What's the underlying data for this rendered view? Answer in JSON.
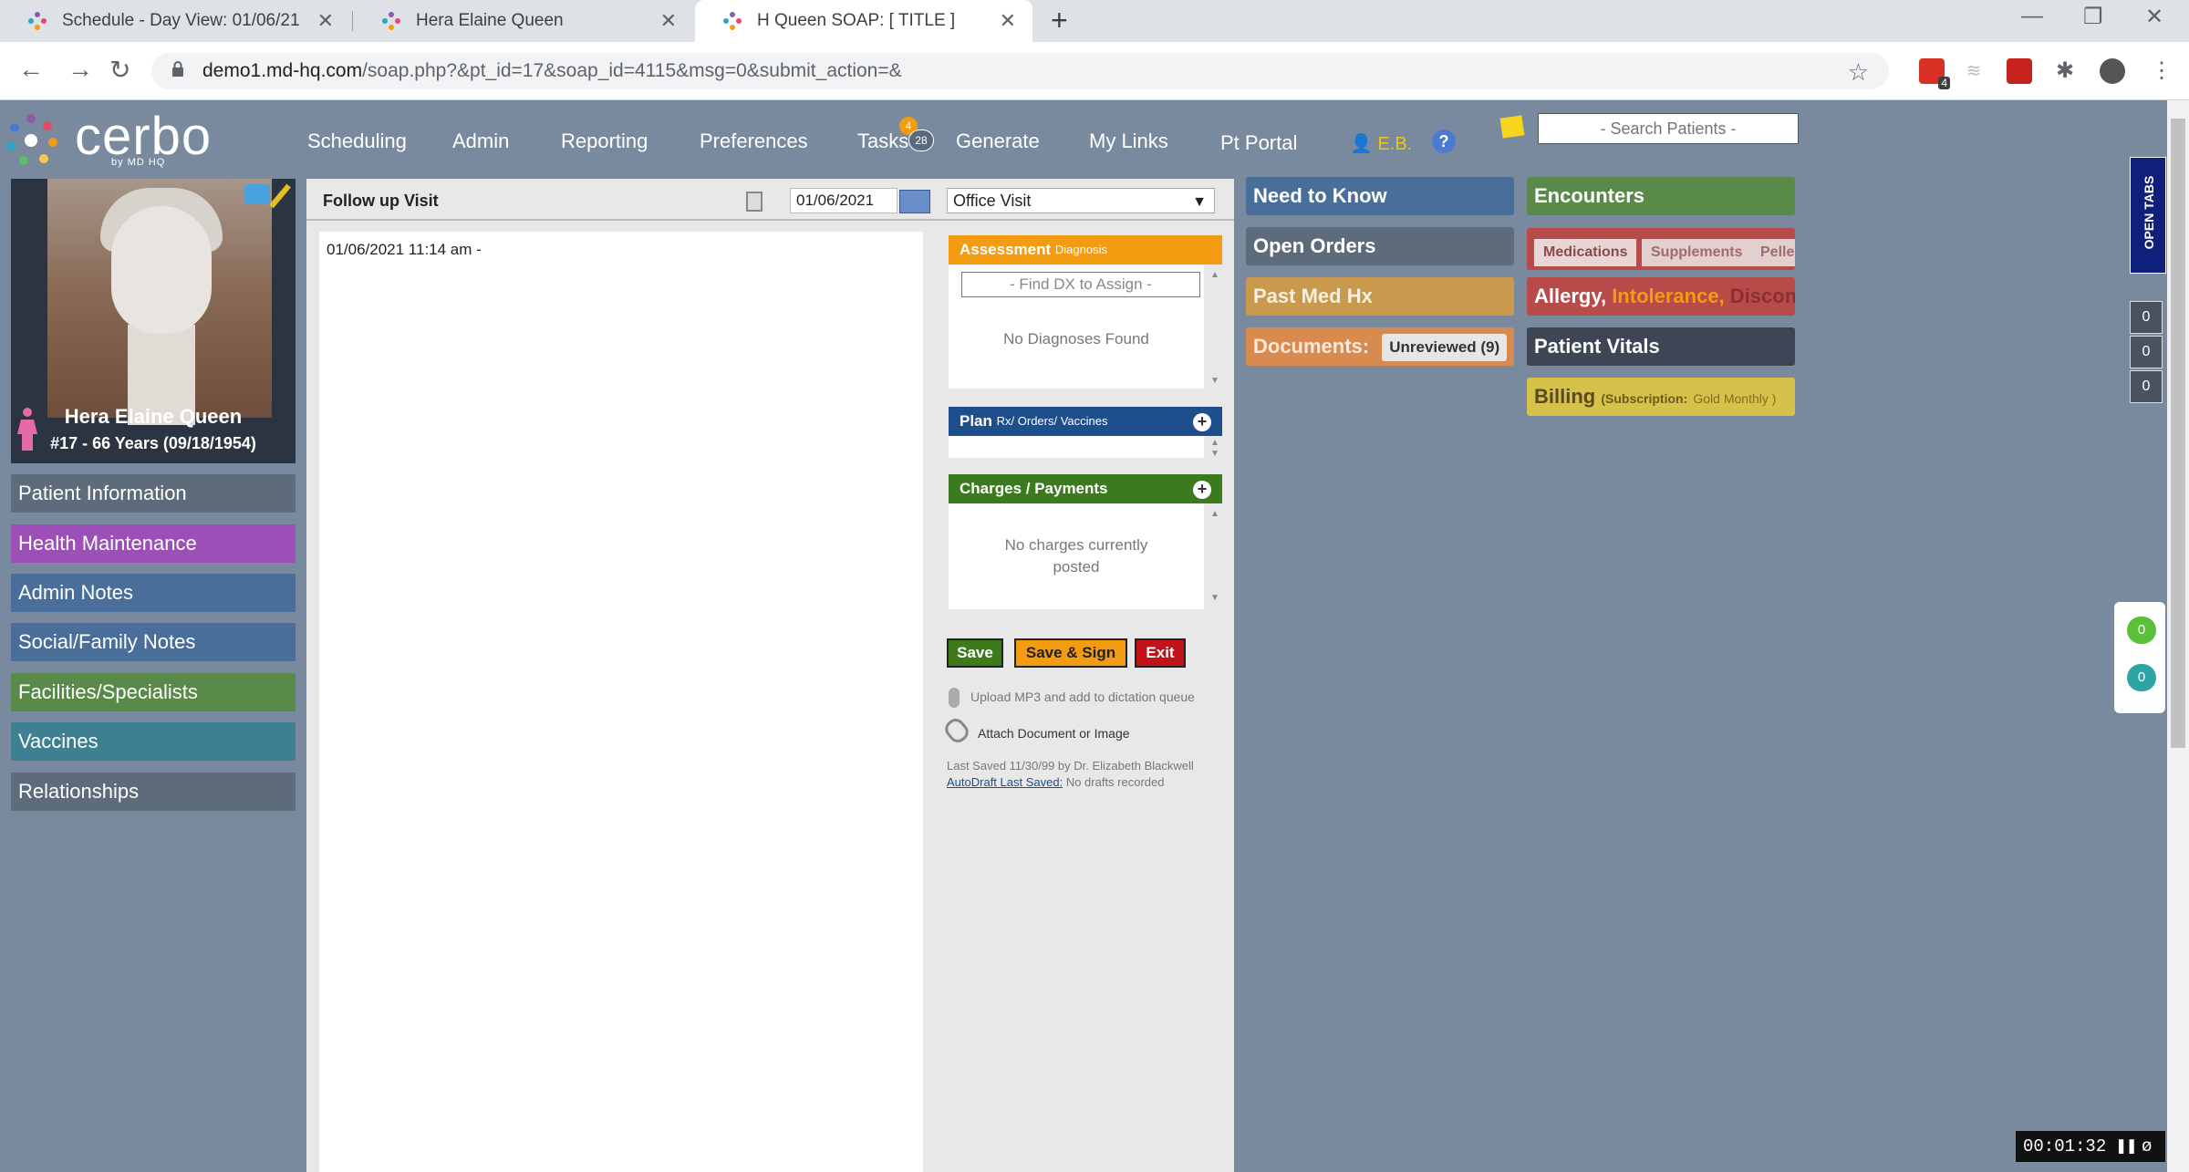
{
  "browser": {
    "tabs": [
      {
        "title": "Schedule - Day View: 01/06/21"
      },
      {
        "title": "Hera Elaine Queen"
      },
      {
        "title": "H Queen SOAP: [ TITLE ]"
      }
    ],
    "url_host": "demo1.md-hq.com",
    "url_path": "/soap.php?&pt_id=17&soap_id=4115&msg=0&submit_action=&",
    "ext_badge": "4"
  },
  "app": {
    "logo_text": "cerbo",
    "logo_sub": "by MD HQ",
    "nav": {
      "scheduling": "Scheduling",
      "admin": "Admin",
      "reporting": "Reporting",
      "preferences": "Preferences",
      "tasks": "Tasks",
      "tasks_badge": "4",
      "tasks_count": "28",
      "generate": "Generate",
      "my_links": "My Links",
      "pt_portal": "Pt Portal",
      "user": "E.B.",
      "help": "?"
    },
    "search_placeholder": "- Search Patients -"
  },
  "patient": {
    "name": "Hera Elaine Queen",
    "info": "#17 - 66 Years (09/18/1954)"
  },
  "sidebar": {
    "items": [
      {
        "label": "Patient Information",
        "color": "#5d6b7a"
      },
      {
        "label": "Health Maintenance",
        "color": "#9b4fb7"
      },
      {
        "label": "Admin Notes",
        "color": "#4a6e9a"
      },
      {
        "label": "Social/Family Notes",
        "color": "#4a6e9a"
      },
      {
        "label": "Facilities/Specialists",
        "color": "#5a8a4a"
      },
      {
        "label": "Vaccines",
        "color": "#3f7f92"
      },
      {
        "label": "Relationships",
        "color": "#5d6b7a"
      }
    ]
  },
  "soap": {
    "visit_title": "Follow up Visit",
    "date": "01/06/2021",
    "visit_type": "Office Visit",
    "note_text": "01/06/2021 11:14 am -",
    "assessment": {
      "label": "Assessment",
      "sub": "Diagnosis",
      "find_placeholder": "- Find DX to Assign -",
      "empty": "No Diagnoses Found"
    },
    "plan": {
      "label": "Plan",
      "sub": "Rx/ Orders/ Vaccines"
    },
    "charges": {
      "label": "Charges / Payments",
      "empty_line1": "No charges currently",
      "empty_line2": "posted"
    },
    "buttons": {
      "save": "Save",
      "save_sign": "Save & Sign",
      "exit": "Exit"
    },
    "upload_text": "Upload MP3 and add to dictation queue",
    "attach_text": "Attach Document or Image",
    "last_saved": "Last Saved 11/30/99 by Dr. Elizabeth Blackwell",
    "autodraft_label": "AutoDraft Last Saved:",
    "autodraft_value": "No drafts recorded"
  },
  "widgets": {
    "need_to_know": "Need to Know",
    "open_orders": "Open Orders",
    "past_med_hx": "Past Med Hx",
    "documents": "Documents:",
    "unreviewed": "Unreviewed (9)",
    "encounters": "Encounters",
    "medications": "Medications",
    "supplements": "Supplements",
    "pellets": "Pelle",
    "allergy": "Allergy,",
    "intolerance": "Intolerance,",
    "discont": "Discont.",
    "patient_vitals": "Patient Vitals",
    "billing": "Billing",
    "billing_sub_open": "(Subscription:",
    "billing_plan": "Gold Monthly )"
  },
  "right_rail": {
    "open_tabs": "OPEN TABS",
    "counters": [
      "0",
      "0",
      "0"
    ],
    "chat_counts": [
      "0",
      "0"
    ],
    "timer": "00:01:32"
  },
  "colors": {
    "bg": "#7a8a9e",
    "need_to_know": "#4a6e9a",
    "open_orders": "#5d6b7a",
    "past_med_hx": "#c99a4e",
    "documents": "#d98a4e",
    "encounters": "#5a8a4a",
    "allergy": "#b84a4a",
    "patient_vitals": "#3e4656",
    "billing": "#d6c14a"
  }
}
